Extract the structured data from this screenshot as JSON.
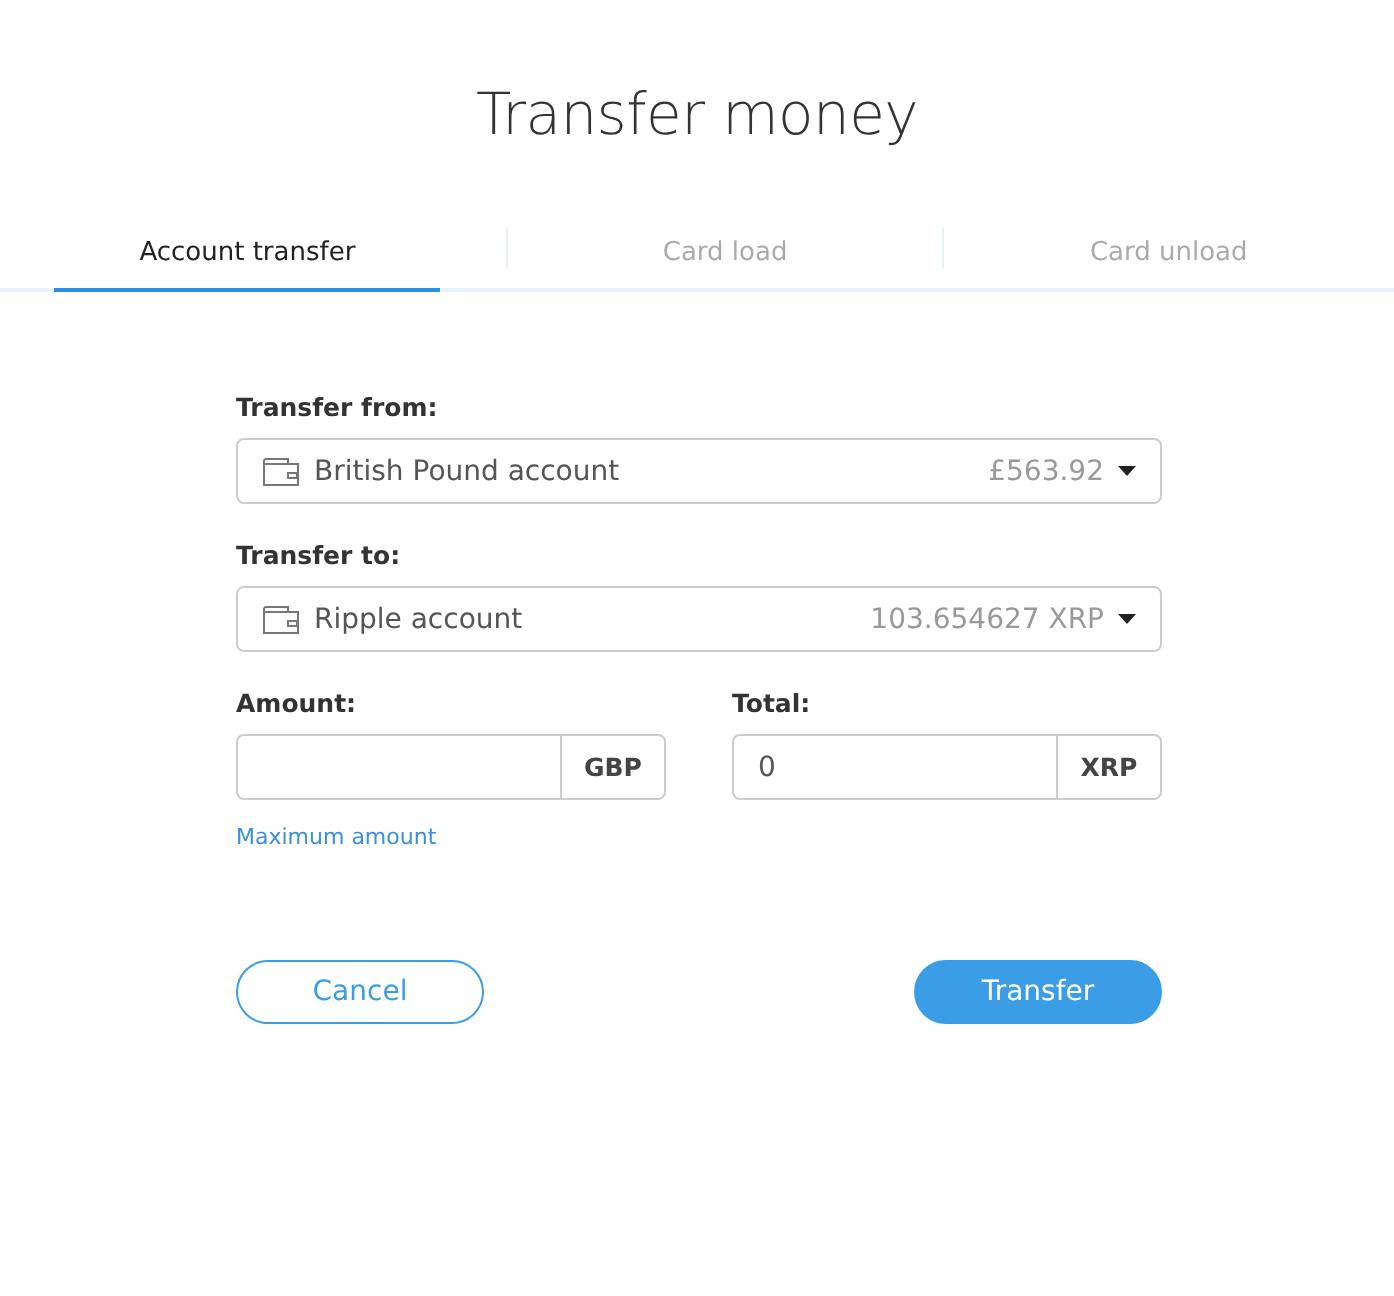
{
  "title": "Transfer money",
  "tabs": [
    {
      "label": "Account transfer",
      "selected": true
    },
    {
      "label": "Card load",
      "selected": false
    },
    {
      "label": "Card unload",
      "selected": false
    }
  ],
  "transfer_from": {
    "label": "Transfer from:",
    "account": "British Pound account",
    "balance": "£563.92"
  },
  "transfer_to": {
    "label": "Transfer to:",
    "account": "Ripple account",
    "balance": "103.654627 XRP"
  },
  "amount": {
    "label": "Amount:",
    "unit": "GBP"
  },
  "total": {
    "label": "Total:",
    "value": "0",
    "unit": "XRP"
  },
  "max_link": "Maximum amount",
  "buttons": [
    {
      "kind": "secondary",
      "label": "Cancel"
    },
    {
      "kind": "primary",
      "label": "Transfer"
    }
  ]
}
